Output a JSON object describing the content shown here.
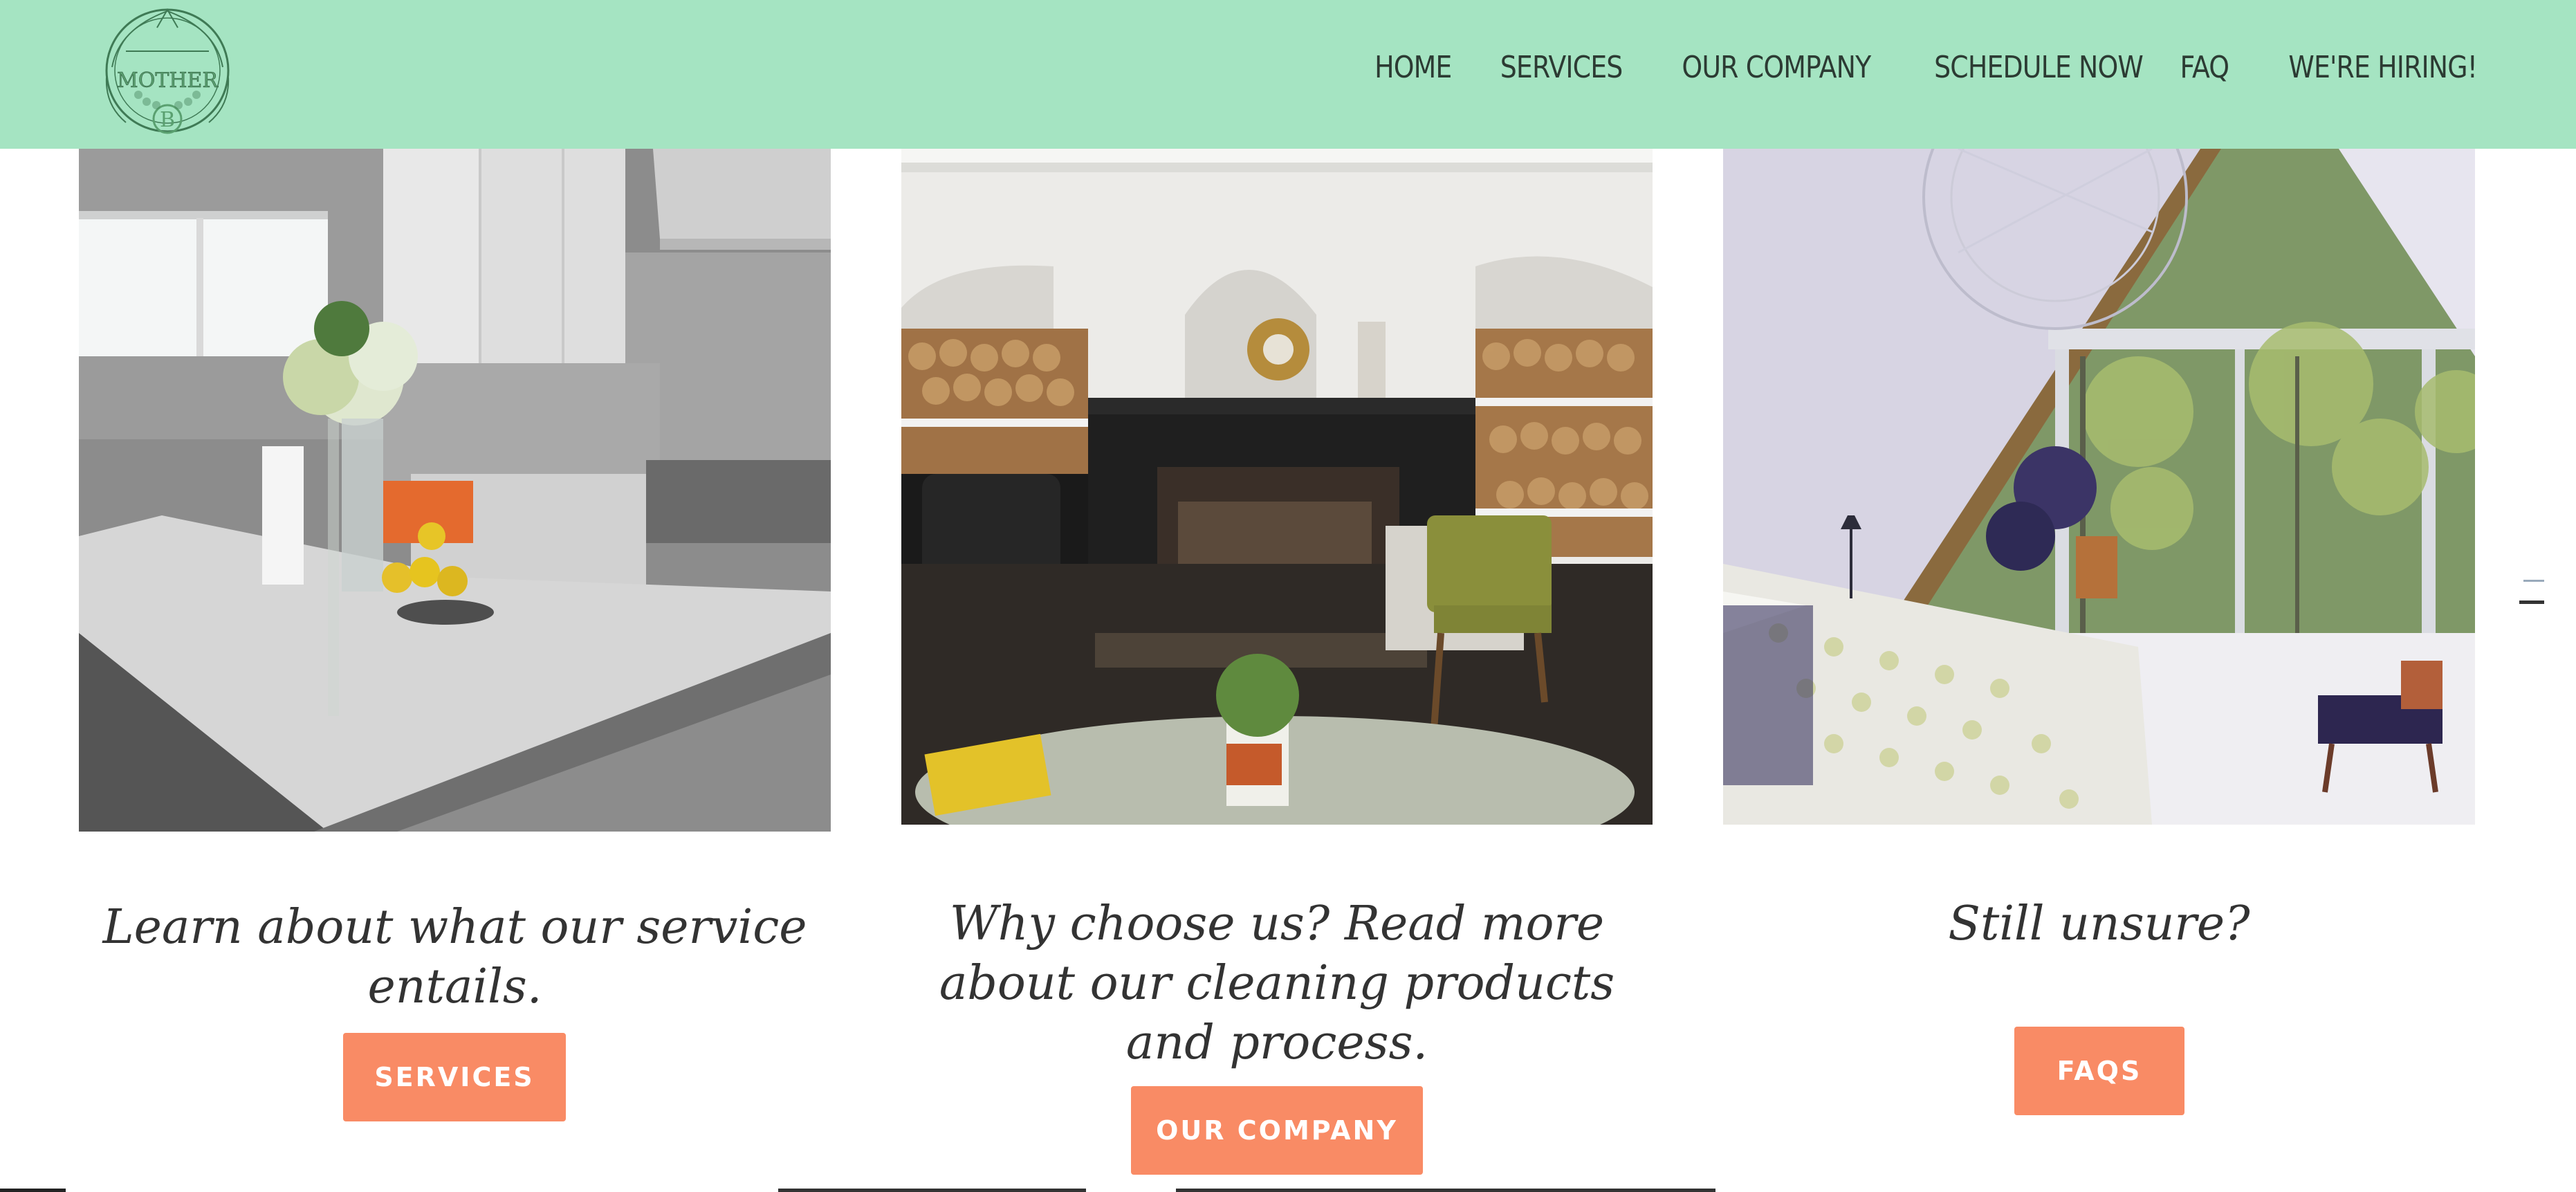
{
  "brand": {
    "logo_text": "MOTHER",
    "logo_initial": "B"
  },
  "nav": [
    {
      "label": "HOME"
    },
    {
      "label": "SERVICES"
    },
    {
      "label": "OUR COMPANY"
    },
    {
      "label": "SCHEDULE NOW"
    },
    {
      "label": "FAQ"
    },
    {
      "label": "WE'RE HIRING!"
    }
  ],
  "cards": [
    {
      "caption": "Learn about what our service entails.",
      "button": "SERVICES",
      "image": "kitchen-photo"
    },
    {
      "caption": "Why choose us? Read more about our cleaning products and process.",
      "button": "OUR COMPANY",
      "image": "fireplace-living-room-photo"
    },
    {
      "caption": "Still unsure?",
      "button": "FAQS",
      "image": "a-frame-bedroom-photo"
    }
  ],
  "colors": {
    "header": "#a5e4c2",
    "button": "#f98b65",
    "text": "#333333"
  }
}
